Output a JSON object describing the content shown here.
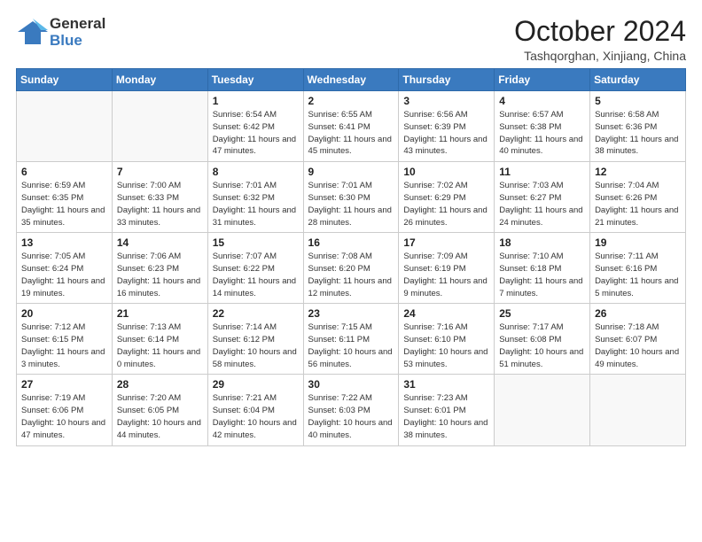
{
  "header": {
    "logo_general": "General",
    "logo_blue": "Blue",
    "title": "October 2024",
    "location": "Tashqorghan, Xinjiang, China"
  },
  "weekdays": [
    "Sunday",
    "Monday",
    "Tuesday",
    "Wednesday",
    "Thursday",
    "Friday",
    "Saturday"
  ],
  "weeks": [
    [
      {
        "day": "",
        "sunrise": "",
        "sunset": "",
        "daylight": ""
      },
      {
        "day": "",
        "sunrise": "",
        "sunset": "",
        "daylight": ""
      },
      {
        "day": "1",
        "sunrise": "Sunrise: 6:54 AM",
        "sunset": "Sunset: 6:42 PM",
        "daylight": "Daylight: 11 hours and 47 minutes."
      },
      {
        "day": "2",
        "sunrise": "Sunrise: 6:55 AM",
        "sunset": "Sunset: 6:41 PM",
        "daylight": "Daylight: 11 hours and 45 minutes."
      },
      {
        "day": "3",
        "sunrise": "Sunrise: 6:56 AM",
        "sunset": "Sunset: 6:39 PM",
        "daylight": "Daylight: 11 hours and 43 minutes."
      },
      {
        "day": "4",
        "sunrise": "Sunrise: 6:57 AM",
        "sunset": "Sunset: 6:38 PM",
        "daylight": "Daylight: 11 hours and 40 minutes."
      },
      {
        "day": "5",
        "sunrise": "Sunrise: 6:58 AM",
        "sunset": "Sunset: 6:36 PM",
        "daylight": "Daylight: 11 hours and 38 minutes."
      }
    ],
    [
      {
        "day": "6",
        "sunrise": "Sunrise: 6:59 AM",
        "sunset": "Sunset: 6:35 PM",
        "daylight": "Daylight: 11 hours and 35 minutes."
      },
      {
        "day": "7",
        "sunrise": "Sunrise: 7:00 AM",
        "sunset": "Sunset: 6:33 PM",
        "daylight": "Daylight: 11 hours and 33 minutes."
      },
      {
        "day": "8",
        "sunrise": "Sunrise: 7:01 AM",
        "sunset": "Sunset: 6:32 PM",
        "daylight": "Daylight: 11 hours and 31 minutes."
      },
      {
        "day": "9",
        "sunrise": "Sunrise: 7:01 AM",
        "sunset": "Sunset: 6:30 PM",
        "daylight": "Daylight: 11 hours and 28 minutes."
      },
      {
        "day": "10",
        "sunrise": "Sunrise: 7:02 AM",
        "sunset": "Sunset: 6:29 PM",
        "daylight": "Daylight: 11 hours and 26 minutes."
      },
      {
        "day": "11",
        "sunrise": "Sunrise: 7:03 AM",
        "sunset": "Sunset: 6:27 PM",
        "daylight": "Daylight: 11 hours and 24 minutes."
      },
      {
        "day": "12",
        "sunrise": "Sunrise: 7:04 AM",
        "sunset": "Sunset: 6:26 PM",
        "daylight": "Daylight: 11 hours and 21 minutes."
      }
    ],
    [
      {
        "day": "13",
        "sunrise": "Sunrise: 7:05 AM",
        "sunset": "Sunset: 6:24 PM",
        "daylight": "Daylight: 11 hours and 19 minutes."
      },
      {
        "day": "14",
        "sunrise": "Sunrise: 7:06 AM",
        "sunset": "Sunset: 6:23 PM",
        "daylight": "Daylight: 11 hours and 16 minutes."
      },
      {
        "day": "15",
        "sunrise": "Sunrise: 7:07 AM",
        "sunset": "Sunset: 6:22 PM",
        "daylight": "Daylight: 11 hours and 14 minutes."
      },
      {
        "day": "16",
        "sunrise": "Sunrise: 7:08 AM",
        "sunset": "Sunset: 6:20 PM",
        "daylight": "Daylight: 11 hours and 12 minutes."
      },
      {
        "day": "17",
        "sunrise": "Sunrise: 7:09 AM",
        "sunset": "Sunset: 6:19 PM",
        "daylight": "Daylight: 11 hours and 9 minutes."
      },
      {
        "day": "18",
        "sunrise": "Sunrise: 7:10 AM",
        "sunset": "Sunset: 6:18 PM",
        "daylight": "Daylight: 11 hours and 7 minutes."
      },
      {
        "day": "19",
        "sunrise": "Sunrise: 7:11 AM",
        "sunset": "Sunset: 6:16 PM",
        "daylight": "Daylight: 11 hours and 5 minutes."
      }
    ],
    [
      {
        "day": "20",
        "sunrise": "Sunrise: 7:12 AM",
        "sunset": "Sunset: 6:15 PM",
        "daylight": "Daylight: 11 hours and 3 minutes."
      },
      {
        "day": "21",
        "sunrise": "Sunrise: 7:13 AM",
        "sunset": "Sunset: 6:14 PM",
        "daylight": "Daylight: 11 hours and 0 minutes."
      },
      {
        "day": "22",
        "sunrise": "Sunrise: 7:14 AM",
        "sunset": "Sunset: 6:12 PM",
        "daylight": "Daylight: 10 hours and 58 minutes."
      },
      {
        "day": "23",
        "sunrise": "Sunrise: 7:15 AM",
        "sunset": "Sunset: 6:11 PM",
        "daylight": "Daylight: 10 hours and 56 minutes."
      },
      {
        "day": "24",
        "sunrise": "Sunrise: 7:16 AM",
        "sunset": "Sunset: 6:10 PM",
        "daylight": "Daylight: 10 hours and 53 minutes."
      },
      {
        "day": "25",
        "sunrise": "Sunrise: 7:17 AM",
        "sunset": "Sunset: 6:08 PM",
        "daylight": "Daylight: 10 hours and 51 minutes."
      },
      {
        "day": "26",
        "sunrise": "Sunrise: 7:18 AM",
        "sunset": "Sunset: 6:07 PM",
        "daylight": "Daylight: 10 hours and 49 minutes."
      }
    ],
    [
      {
        "day": "27",
        "sunrise": "Sunrise: 7:19 AM",
        "sunset": "Sunset: 6:06 PM",
        "daylight": "Daylight: 10 hours and 47 minutes."
      },
      {
        "day": "28",
        "sunrise": "Sunrise: 7:20 AM",
        "sunset": "Sunset: 6:05 PM",
        "daylight": "Daylight: 10 hours and 44 minutes."
      },
      {
        "day": "29",
        "sunrise": "Sunrise: 7:21 AM",
        "sunset": "Sunset: 6:04 PM",
        "daylight": "Daylight: 10 hours and 42 minutes."
      },
      {
        "day": "30",
        "sunrise": "Sunrise: 7:22 AM",
        "sunset": "Sunset: 6:03 PM",
        "daylight": "Daylight: 10 hours and 40 minutes."
      },
      {
        "day": "31",
        "sunrise": "Sunrise: 7:23 AM",
        "sunset": "Sunset: 6:01 PM",
        "daylight": "Daylight: 10 hours and 38 minutes."
      },
      {
        "day": "",
        "sunrise": "",
        "sunset": "",
        "daylight": ""
      },
      {
        "day": "",
        "sunrise": "",
        "sunset": "",
        "daylight": ""
      }
    ]
  ]
}
